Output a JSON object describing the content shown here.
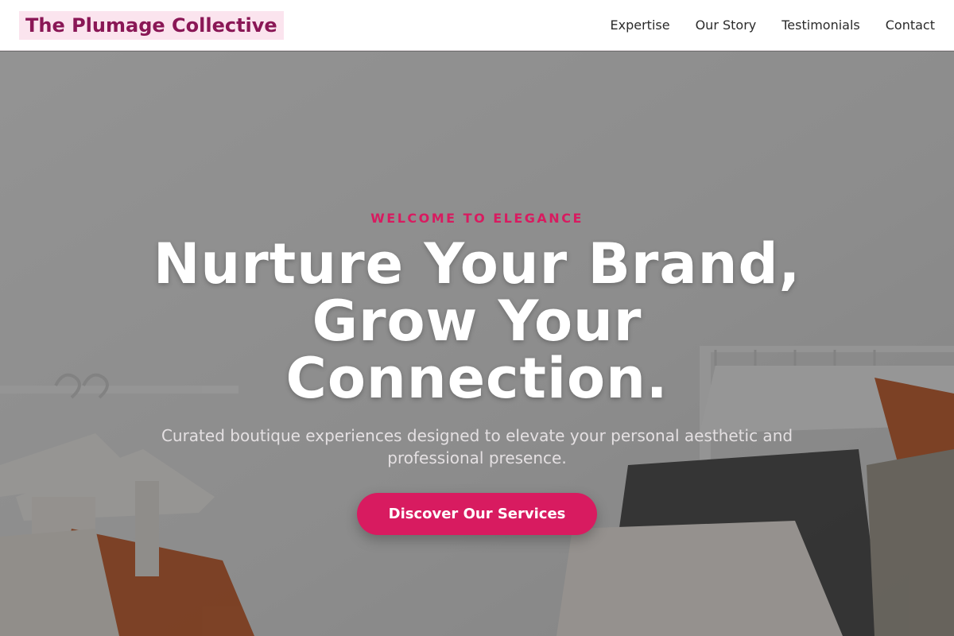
{
  "brand": {
    "name": "The Plumage Collective"
  },
  "nav": {
    "items": [
      {
        "label": "Expertise"
      },
      {
        "label": "Our Story"
      },
      {
        "label": "Testimonials"
      },
      {
        "label": "Contact"
      }
    ]
  },
  "hero": {
    "eyebrow": "WELCOME TO ELEGANCE",
    "headline": "Nurture Your Brand, Grow Your Connection.",
    "subtitle": "Curated boutique experiences designed to elevate your personal aesthetic and professional presence.",
    "cta_label": "Discover Our Services",
    "background_image": "clothing-rack-hangers-photo"
  },
  "colors": {
    "accent": "#d81b60",
    "logo_text": "#8a1756",
    "logo_bg": "#fbe4ee"
  }
}
